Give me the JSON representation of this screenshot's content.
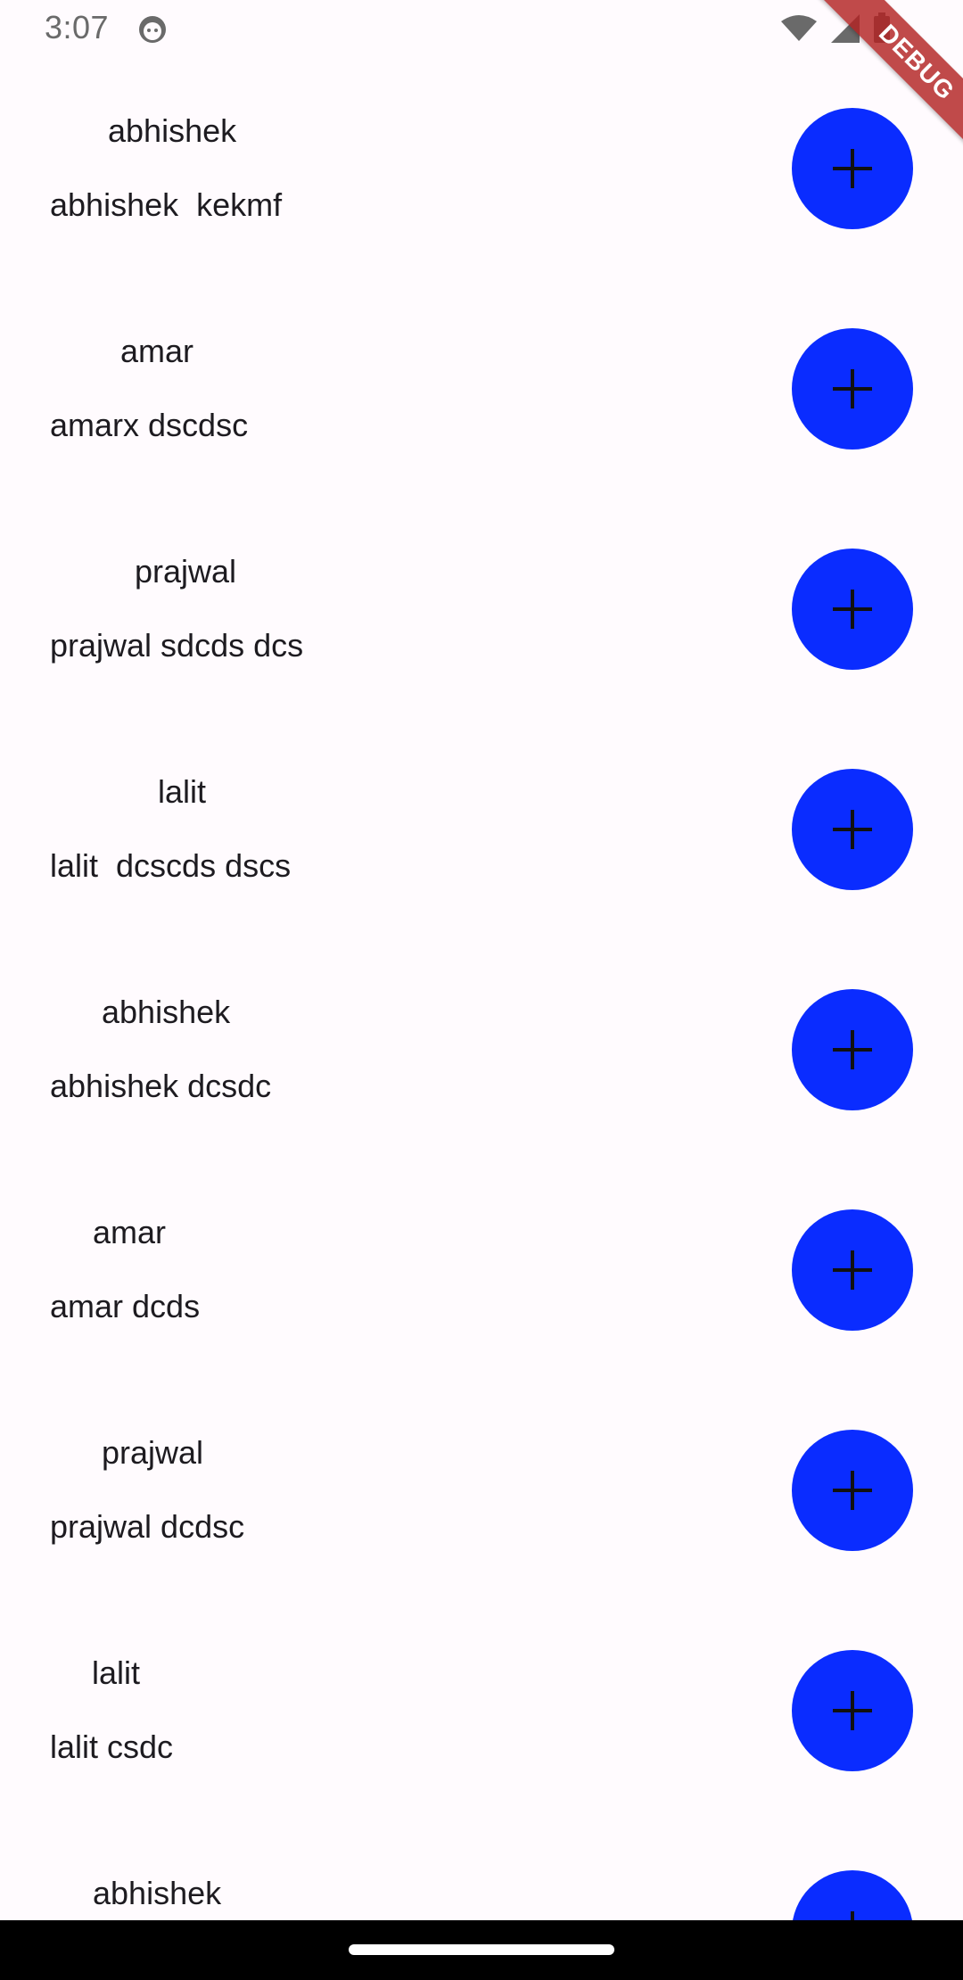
{
  "status_bar": {
    "time": "3:07",
    "icons": [
      "app-face-icon",
      "wifi-icon",
      "cell-signal-icon",
      "battery-icon"
    ]
  },
  "debug_banner": {
    "label": "DEBUG"
  },
  "colors": {
    "background": "#fffbfe",
    "button": "#0a2cff",
    "text": "#1d1b20",
    "debug_banner": "#b22222"
  },
  "list": {
    "items": [
      {
        "title": "abhishek",
        "subtitle": "abhishek  kekmf",
        "button_icon": "plus-icon"
      },
      {
        "title": "amar",
        "subtitle": "amarx dscdsc",
        "button_icon": "plus-icon"
      },
      {
        "title": "prajwal",
        "subtitle": "prajwal sdcds dcs",
        "button_icon": "plus-icon"
      },
      {
        "title": "lalit",
        "subtitle": "lalit  dcscds dscs",
        "button_icon": "plus-icon"
      },
      {
        "title": "abhishek",
        "subtitle": "abhishek dcsdc",
        "button_icon": "plus-icon"
      },
      {
        "title": "amar",
        "subtitle": "amar dcds",
        "button_icon": "plus-icon"
      },
      {
        "title": "prajwal",
        "subtitle": "prajwal dcdsc",
        "button_icon": "plus-icon"
      },
      {
        "title": "lalit",
        "subtitle": "lalit csdc",
        "button_icon": "plus-icon"
      },
      {
        "title": "abhishek",
        "subtitle": "",
        "button_icon": "plus-icon"
      }
    ]
  }
}
